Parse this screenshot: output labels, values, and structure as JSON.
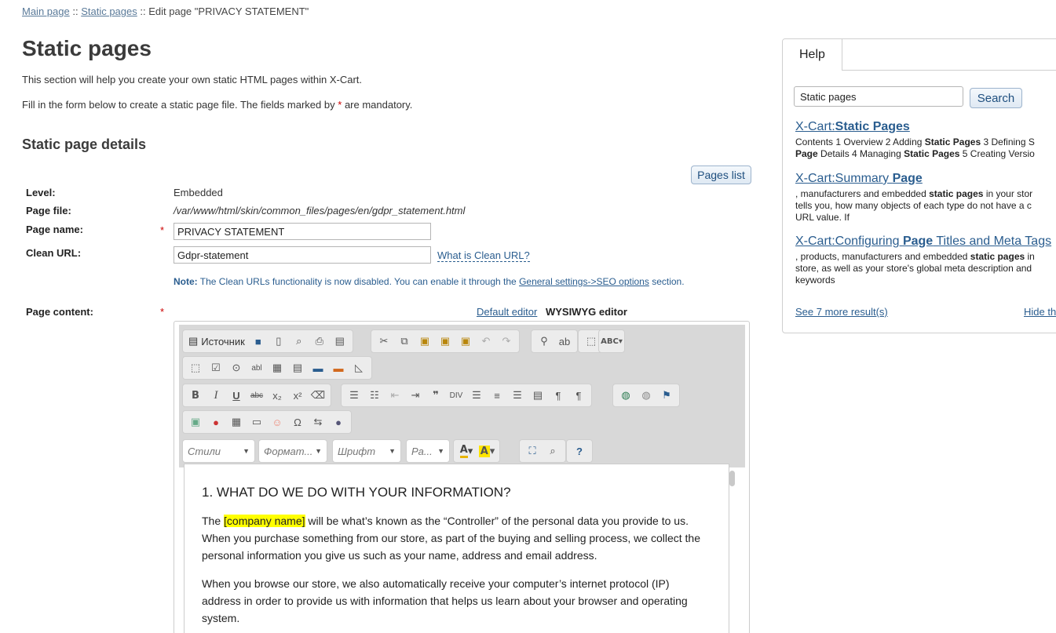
{
  "breadcrumb": {
    "main": "Main page",
    "sep1": "::",
    "static": "Static pages",
    "sep2": "::",
    "current": "Edit page \"PRIVACY STATEMENT\""
  },
  "title": "Static pages",
  "intro1": "This section will help you create your own static HTML pages within X-Cart.",
  "intro2_a": "Fill in the form below to create a static page file. The fields marked by",
  "intro2_star": "*",
  "intro2_b": "are mandatory.",
  "section_title": "Static page details",
  "pages_list_button": "Pages list",
  "form": {
    "level_label": "Level:",
    "level_value": "Embedded",
    "file_label": "Page file:",
    "file_value": "/var/www/html/skin/common_files/pages/en/gdpr_statement.html",
    "name_label": "Page name:",
    "name_value": "PRIVACY STATEMENT",
    "url_label": "Clean URL:",
    "url_value": "Gdpr-statement",
    "url_help": "What is Clean URL?",
    "note_bold": "Note:",
    "note_text": "The Clean URLs functionality is now disabled. You can enable it through the",
    "note_link": "General settings->SEO options",
    "note_tail": "section.",
    "content_label": "Page content:",
    "star": "*"
  },
  "editor": {
    "default_link": "Default editor",
    "wysiwyg_label": "WYSIWYG editor",
    "source_label": "Источник",
    "combos": {
      "styles": "Стили",
      "format": "Формат...",
      "font": "Шрифт",
      "size": "Ра..."
    },
    "heading": "1. WHAT DO WE DO WITH YOUR INFORMATION?",
    "p1_a": "The",
    "p1_hl": "[company name]",
    "p1_b": "will be what’s known as the “Controller” of the personal data you provide to us. When you purchase something from our store, as part of the buying and selling process, we collect the personal information you give us such as your name, address and email address.",
    "p2": "When you browse our store, we also automatically receive your computer’s internet protocol (IP) address in order to provide us with information that helps us learn about your browser and operating system."
  },
  "help": {
    "tab": "Help",
    "search_value": "Static pages",
    "search_button": "Search",
    "results": [
      {
        "t1": "X-Cart:",
        "t2": "Static Pages",
        "t3": "",
        "d1": "Contents 1 Overview 2 Adding ",
        "d1b": "Static Pages",
        "d1c": " 3 Defining S",
        "d2": "Page",
        "d2b": " Details 4 Managing ",
        "d2c": "Static Pages",
        "d2d": " 5 Creating Versio"
      },
      {
        "t1": "X-Cart:Summary ",
        "t2": "Page",
        "t3": "",
        "d1": ", manufacturers and embedded ",
        "d1b": "static pages",
        "d1c": " in your stor",
        "d2": "tells you, how many objects of each type do not have a c",
        "d3": "URL value. If"
      },
      {
        "t1": "X-Cart:Configuring ",
        "t2": "Page",
        "t3": " Titles and Meta Tags",
        "d1": ", products, manufacturers and embedded ",
        "d1b": "static pages",
        "d1c": " in",
        "d2": "store, as well as your store's global meta description and",
        "d3": "keywords"
      }
    ],
    "more": "See 7 more result(s)",
    "hide": "Hide th"
  },
  "accent": "#2a5d8f"
}
